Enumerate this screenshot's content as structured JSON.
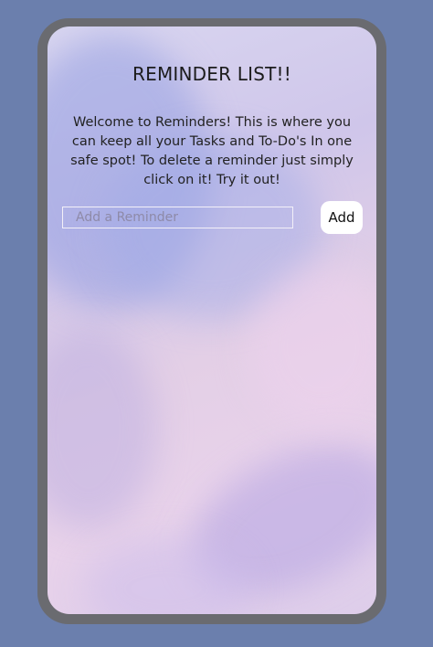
{
  "app": {
    "title": "REMINDER LIST!!",
    "intro": "Welcome to Reminders! This is where you can keep all your Tasks and To-Do's In one safe spot! To delete a reminder just simply click on it! Try it out!"
  },
  "form": {
    "input_placeholder": "Add a Reminder",
    "input_value": "",
    "add_label": "Add"
  },
  "reminders": [],
  "colors": {
    "page_background": "#6b7fad",
    "frame": "#6a6b70",
    "button_background": "#ffffff"
  }
}
